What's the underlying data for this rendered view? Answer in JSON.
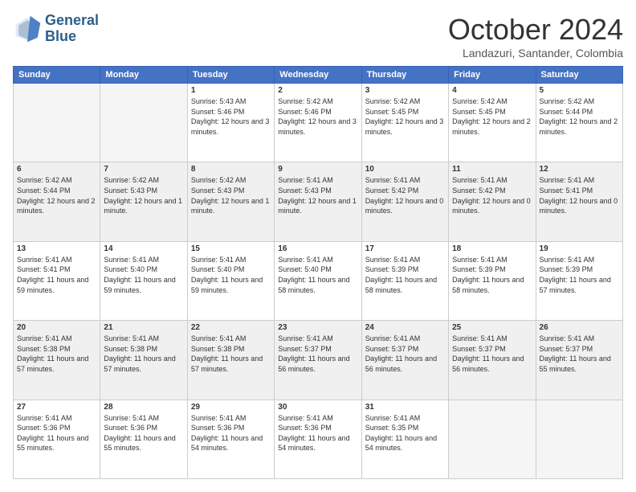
{
  "header": {
    "logo_line1": "General",
    "logo_line2": "Blue",
    "month_title": "October 2024",
    "location": "Landazuri, Santander, Colombia"
  },
  "weekdays": [
    "Sunday",
    "Monday",
    "Tuesday",
    "Wednesday",
    "Thursday",
    "Friday",
    "Saturday"
  ],
  "weeks": [
    [
      {
        "day": "",
        "info": ""
      },
      {
        "day": "",
        "info": ""
      },
      {
        "day": "1",
        "info": "Sunrise: 5:43 AM\nSunset: 5:46 PM\nDaylight: 12 hours and 3 minutes."
      },
      {
        "day": "2",
        "info": "Sunrise: 5:42 AM\nSunset: 5:46 PM\nDaylight: 12 hours and 3 minutes."
      },
      {
        "day": "3",
        "info": "Sunrise: 5:42 AM\nSunset: 5:45 PM\nDaylight: 12 hours and 3 minutes."
      },
      {
        "day": "4",
        "info": "Sunrise: 5:42 AM\nSunset: 5:45 PM\nDaylight: 12 hours and 2 minutes."
      },
      {
        "day": "5",
        "info": "Sunrise: 5:42 AM\nSunset: 5:44 PM\nDaylight: 12 hours and 2 minutes."
      }
    ],
    [
      {
        "day": "6",
        "info": "Sunrise: 5:42 AM\nSunset: 5:44 PM\nDaylight: 12 hours and 2 minutes."
      },
      {
        "day": "7",
        "info": "Sunrise: 5:42 AM\nSunset: 5:43 PM\nDaylight: 12 hours and 1 minute."
      },
      {
        "day": "8",
        "info": "Sunrise: 5:42 AM\nSunset: 5:43 PM\nDaylight: 12 hours and 1 minute."
      },
      {
        "day": "9",
        "info": "Sunrise: 5:41 AM\nSunset: 5:43 PM\nDaylight: 12 hours and 1 minute."
      },
      {
        "day": "10",
        "info": "Sunrise: 5:41 AM\nSunset: 5:42 PM\nDaylight: 12 hours and 0 minutes."
      },
      {
        "day": "11",
        "info": "Sunrise: 5:41 AM\nSunset: 5:42 PM\nDaylight: 12 hours and 0 minutes."
      },
      {
        "day": "12",
        "info": "Sunrise: 5:41 AM\nSunset: 5:41 PM\nDaylight: 12 hours and 0 minutes."
      }
    ],
    [
      {
        "day": "13",
        "info": "Sunrise: 5:41 AM\nSunset: 5:41 PM\nDaylight: 11 hours and 59 minutes."
      },
      {
        "day": "14",
        "info": "Sunrise: 5:41 AM\nSunset: 5:40 PM\nDaylight: 11 hours and 59 minutes."
      },
      {
        "day": "15",
        "info": "Sunrise: 5:41 AM\nSunset: 5:40 PM\nDaylight: 11 hours and 59 minutes."
      },
      {
        "day": "16",
        "info": "Sunrise: 5:41 AM\nSunset: 5:40 PM\nDaylight: 11 hours and 58 minutes."
      },
      {
        "day": "17",
        "info": "Sunrise: 5:41 AM\nSunset: 5:39 PM\nDaylight: 11 hours and 58 minutes."
      },
      {
        "day": "18",
        "info": "Sunrise: 5:41 AM\nSunset: 5:39 PM\nDaylight: 11 hours and 58 minutes."
      },
      {
        "day": "19",
        "info": "Sunrise: 5:41 AM\nSunset: 5:39 PM\nDaylight: 11 hours and 57 minutes."
      }
    ],
    [
      {
        "day": "20",
        "info": "Sunrise: 5:41 AM\nSunset: 5:38 PM\nDaylight: 11 hours and 57 minutes."
      },
      {
        "day": "21",
        "info": "Sunrise: 5:41 AM\nSunset: 5:38 PM\nDaylight: 11 hours and 57 minutes."
      },
      {
        "day": "22",
        "info": "Sunrise: 5:41 AM\nSunset: 5:38 PM\nDaylight: 11 hours and 57 minutes."
      },
      {
        "day": "23",
        "info": "Sunrise: 5:41 AM\nSunset: 5:37 PM\nDaylight: 11 hours and 56 minutes."
      },
      {
        "day": "24",
        "info": "Sunrise: 5:41 AM\nSunset: 5:37 PM\nDaylight: 11 hours and 56 minutes."
      },
      {
        "day": "25",
        "info": "Sunrise: 5:41 AM\nSunset: 5:37 PM\nDaylight: 11 hours and 56 minutes."
      },
      {
        "day": "26",
        "info": "Sunrise: 5:41 AM\nSunset: 5:37 PM\nDaylight: 11 hours and 55 minutes."
      }
    ],
    [
      {
        "day": "27",
        "info": "Sunrise: 5:41 AM\nSunset: 5:36 PM\nDaylight: 11 hours and 55 minutes."
      },
      {
        "day": "28",
        "info": "Sunrise: 5:41 AM\nSunset: 5:36 PM\nDaylight: 11 hours and 55 minutes."
      },
      {
        "day": "29",
        "info": "Sunrise: 5:41 AM\nSunset: 5:36 PM\nDaylight: 11 hours and 54 minutes."
      },
      {
        "day": "30",
        "info": "Sunrise: 5:41 AM\nSunset: 5:36 PM\nDaylight: 11 hours and 54 minutes."
      },
      {
        "day": "31",
        "info": "Sunrise: 5:41 AM\nSunset: 5:35 PM\nDaylight: 11 hours and 54 minutes."
      },
      {
        "day": "",
        "info": ""
      },
      {
        "day": "",
        "info": ""
      }
    ]
  ]
}
